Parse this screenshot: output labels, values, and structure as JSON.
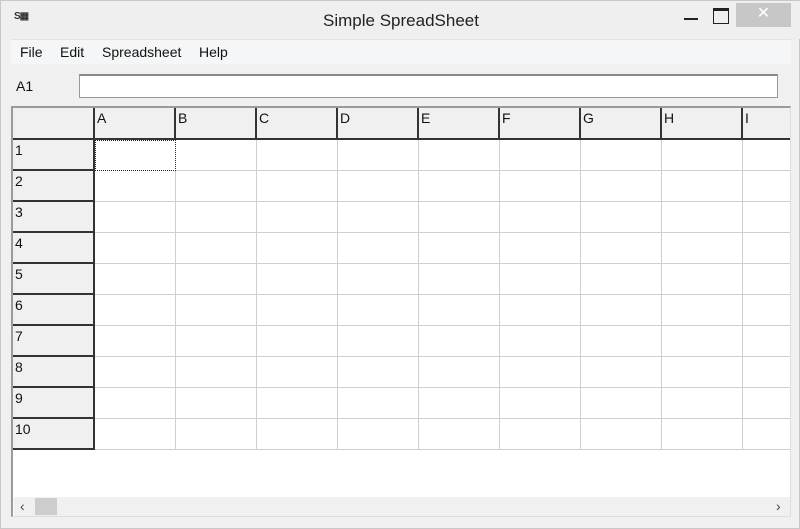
{
  "window": {
    "title": "Simple SpreadSheet",
    "icon": "spreadsheet-app-icon",
    "close": "✕"
  },
  "menu": [
    "File",
    "Edit",
    "Spreadsheet",
    "Help"
  ],
  "formula_bar": {
    "cell_ref": "A1",
    "value": ""
  },
  "grid": {
    "columns": [
      "A",
      "B",
      "C",
      "D",
      "E",
      "F",
      "G",
      "H",
      "I"
    ],
    "rows": [
      "1",
      "2",
      "3",
      "4",
      "5",
      "6",
      "7",
      "8",
      "9",
      "10"
    ],
    "selected": "A1"
  },
  "scrollbar": {
    "left": "‹",
    "right": "›"
  }
}
